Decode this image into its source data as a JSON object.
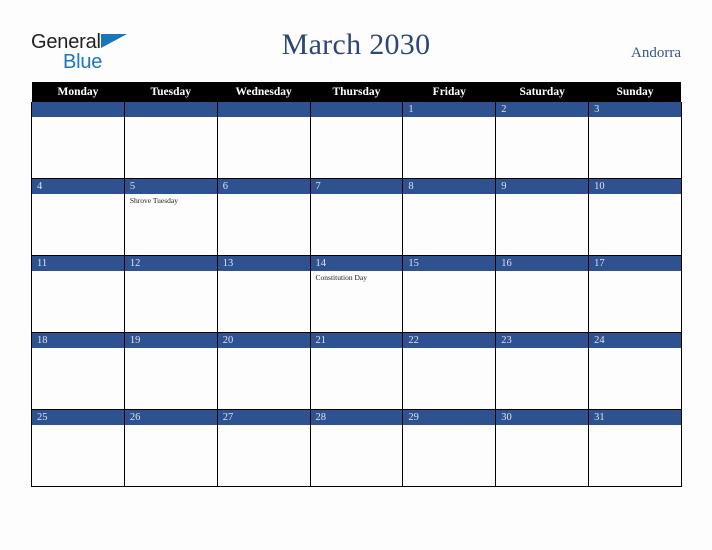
{
  "brand": {
    "name_part1": "General",
    "name_part2": "Blue",
    "color_dark": "#231f20",
    "color_blue": "#1b75bb"
  },
  "header": {
    "title": "March 2030",
    "country": "Andorra",
    "title_color": "#2f4575"
  },
  "calendar": {
    "month": "March",
    "year": "2030",
    "accent_color": "#2e5190",
    "header_bg": "#000000",
    "weekdays": [
      "Monday",
      "Tuesday",
      "Wednesday",
      "Thursday",
      "Friday",
      "Saturday",
      "Sunday"
    ],
    "weeks": [
      [
        {
          "date": "",
          "event": ""
        },
        {
          "date": "",
          "event": ""
        },
        {
          "date": "",
          "event": ""
        },
        {
          "date": "",
          "event": ""
        },
        {
          "date": "1",
          "event": ""
        },
        {
          "date": "2",
          "event": ""
        },
        {
          "date": "3",
          "event": ""
        }
      ],
      [
        {
          "date": "4",
          "event": ""
        },
        {
          "date": "5",
          "event": "Shrove Tuesday"
        },
        {
          "date": "6",
          "event": ""
        },
        {
          "date": "7",
          "event": ""
        },
        {
          "date": "8",
          "event": ""
        },
        {
          "date": "9",
          "event": ""
        },
        {
          "date": "10",
          "event": ""
        }
      ],
      [
        {
          "date": "11",
          "event": ""
        },
        {
          "date": "12",
          "event": ""
        },
        {
          "date": "13",
          "event": ""
        },
        {
          "date": "14",
          "event": "Constitution Day"
        },
        {
          "date": "15",
          "event": ""
        },
        {
          "date": "16",
          "event": ""
        },
        {
          "date": "17",
          "event": ""
        }
      ],
      [
        {
          "date": "18",
          "event": ""
        },
        {
          "date": "19",
          "event": ""
        },
        {
          "date": "20",
          "event": ""
        },
        {
          "date": "21",
          "event": ""
        },
        {
          "date": "22",
          "event": ""
        },
        {
          "date": "23",
          "event": ""
        },
        {
          "date": "24",
          "event": ""
        }
      ],
      [
        {
          "date": "25",
          "event": ""
        },
        {
          "date": "26",
          "event": ""
        },
        {
          "date": "27",
          "event": ""
        },
        {
          "date": "28",
          "event": ""
        },
        {
          "date": "29",
          "event": ""
        },
        {
          "date": "30",
          "event": ""
        },
        {
          "date": "31",
          "event": ""
        }
      ]
    ]
  }
}
